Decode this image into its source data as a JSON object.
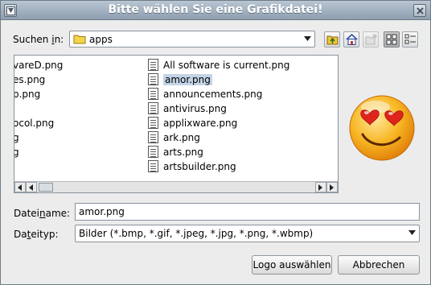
{
  "window": {
    "title": "Bitte wählen Sie eine Grafikdatei!"
  },
  "lookin": {
    "label_pre": "Suchen ",
    "label_ul": "i",
    "label_post": "n:",
    "value": "apps"
  },
  "toolbar": {
    "icons": [
      "folder-up-icon",
      "home-icon",
      "new-folder-icon",
      "list-view-icon",
      "detail-view-icon"
    ]
  },
  "files": {
    "left_column": [
      "vareD.png",
      "es.png",
      "p.png",
      "",
      "ocol.png",
      "g",
      "g"
    ],
    "right_column": [
      "All software is current.png",
      "amor.png",
      "announcements.png",
      "antivirus.png",
      "applixware.png",
      "ark.png",
      "arts.png",
      "artsbuilder.png"
    ],
    "selected": "amor.png"
  },
  "filename": {
    "label_pre": "Datei",
    "label_ul": "n",
    "label_post": "ame:",
    "value": "amor.png"
  },
  "filetype": {
    "label_pre": "Da",
    "label_ul": "t",
    "label_post": "eityp:",
    "value": "Bilder (*.bmp, *.gif, *.jpeg, *.jpg, *.png, *.wbmp)"
  },
  "buttons": {
    "ok": "Logo auswählen",
    "cancel": "Abbrechen"
  },
  "colors": {
    "title_bar": "#9fb0c1",
    "selection": "#c3d4e6"
  }
}
